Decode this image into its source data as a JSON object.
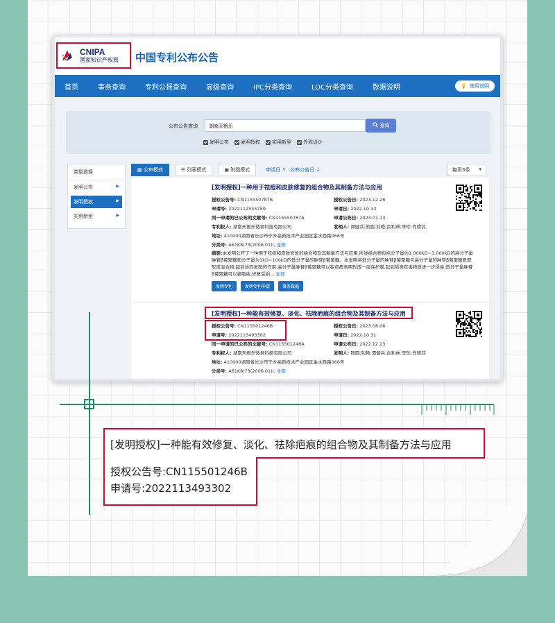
{
  "header": {
    "logo_en": "CNIPA",
    "logo_cn": "国家知识产权局",
    "site_title": "中国专利公布公告"
  },
  "nav": {
    "items": [
      "首页",
      "事务查询",
      "专利公报查询",
      "高级查询",
      "IPC分类查询",
      "LOC分类查询",
      "数据说明"
    ],
    "help": "使用说明"
  },
  "search": {
    "label": "公布公告查询",
    "value": "湖南天根乐",
    "button": "查询",
    "checks": [
      "发明公布",
      "发明授权",
      "实用新型",
      "外观设计"
    ]
  },
  "sidebar": {
    "heading": "类型选择",
    "items": [
      {
        "label": "发明公布"
      },
      {
        "label": "发明授权"
      },
      {
        "label": "实用新型"
      }
    ]
  },
  "toolbar": {
    "modes": [
      "公布模式",
      "列表模式",
      "附图模式"
    ],
    "sort_apply": "申请日 ↑",
    "sort_pub": "公布公告日 ↓",
    "per_page": "每页3条"
  },
  "records": [
    {
      "title": "[发明授权]一种用于祛痘和皮肤修复的组合物及其制备方法与应用",
      "grant_no_label": "授权公告号:",
      "grant_no": "CN115550787B",
      "grant_date_label": "授权公告日:",
      "grant_date": "2023.12.26",
      "app_no_label": "申请号:",
      "app_no": "2022112555759",
      "app_date_label": "申请日:",
      "app_date": "2022.10.13",
      "same_day_label": "同一申请的已公布的文献号:",
      "same_day": "CN115550787A",
      "pub_date_label": "申请公布日:",
      "pub_date": "2023.01.13",
      "holder_label": "专利权人:",
      "holder": "湖南天根乐微君科技有限公司",
      "inventor_label": "发明人:",
      "inventor": "谭健兵;熊圆;刘艳;俞利林;李珍;肖德羽",
      "address_label": "地址:",
      "address": "410000湖南省长沙市宁乡高新技术产业园区金水西路066号",
      "class_label": "分类号:",
      "class": "A61K8/73(2006.01)I;",
      "more": "全部",
      "abstract_label": "摘要:",
      "abstract": "本发明公开了一种用于祛痘和皮肤修复的组合物及其制备方法与应用,所述组合物包括分子量为1.000kD~3.000kD的高分子量肿苷β葡聚糖和分子量为1kD~100kD的低分子量的肿苷β葡聚糖。本发明将低分子量的肿苷β葡聚糖与高分子量的肿苷β葡聚糖复配形成混合物,起到协同复配的作用,高分子量肿苷β葡聚糖可以在痘疮表明形成一层保护膜,起到隔离有害物质进一步侵染,低分子量肿苷β葡聚糖可以被吸收,修复受损...",
      "buttons": [
        "发明专利",
        "发明专利申请",
        "事务数据"
      ]
    },
    {
      "title": "[发明授权]一种能有效修复、淡化、祛除疤痕的组合物及其制备方法与应用",
      "grant_no_label": "授权公告号:",
      "grant_no": "CN115501246B",
      "grant_date_label": "授权公告日:",
      "grant_date": "2023.08.08",
      "app_no_label": "申请号:",
      "app_no": "2022113493302",
      "app_date_label": "申请日:",
      "app_date": "2022.10.31",
      "same_day_label": "同一申请的已公布的文献号:",
      "same_day": "CN115501246A",
      "pub_date_label": "申请公布日:",
      "pub_date": "2022.12.23",
      "holder_label": "专利权人:",
      "holder": "湖南天根乐微君科技有限公司",
      "inventor_label": "发明人:",
      "inventor": "熊圆;刘艳;谭健兵;俞利林;李珍;肖德羽",
      "address_label": "地址:",
      "address": "410000湖南省长沙市宁乡高新技术产业园区金水西路066号",
      "class_label": "分类号:",
      "class": "A61K8/73(2006.01)I;",
      "more": "全部"
    }
  ],
  "callout": {
    "title": "[发明授权]一种能有效修复、淡化、祛除疤痕的组合物及其制备方法与应用",
    "grant_line": "授权公告号:CN115501246B",
    "app_line": "申请号:2022113493302"
  },
  "colors": {
    "background": "#8ac5b4",
    "nav_blue": "#1d6fc2",
    "highlight_red": "#c8102e",
    "ruler_green": "#1e8f68"
  }
}
